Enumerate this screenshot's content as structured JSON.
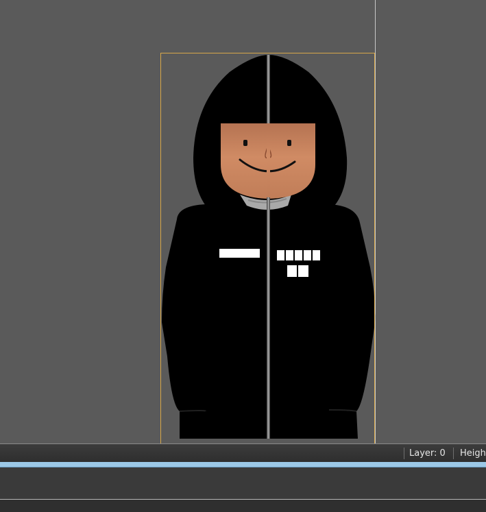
{
  "status_bar": {
    "layer_label": "Layer: 0",
    "height_label": "Heigh"
  },
  "colors": {
    "canvas_background": "#5a5a5a",
    "selection_outline": "#d8a84a",
    "hoodie": "#000000",
    "skin": "#c98560",
    "zipper": "#8c8c8c",
    "collar": "#a9a9a9",
    "timeline_accent": "#9cc8e6"
  },
  "model": {
    "name_tag_blocks": 1,
    "badge_top_row_blocks": 5,
    "badge_bottom_row_blocks": 2
  }
}
